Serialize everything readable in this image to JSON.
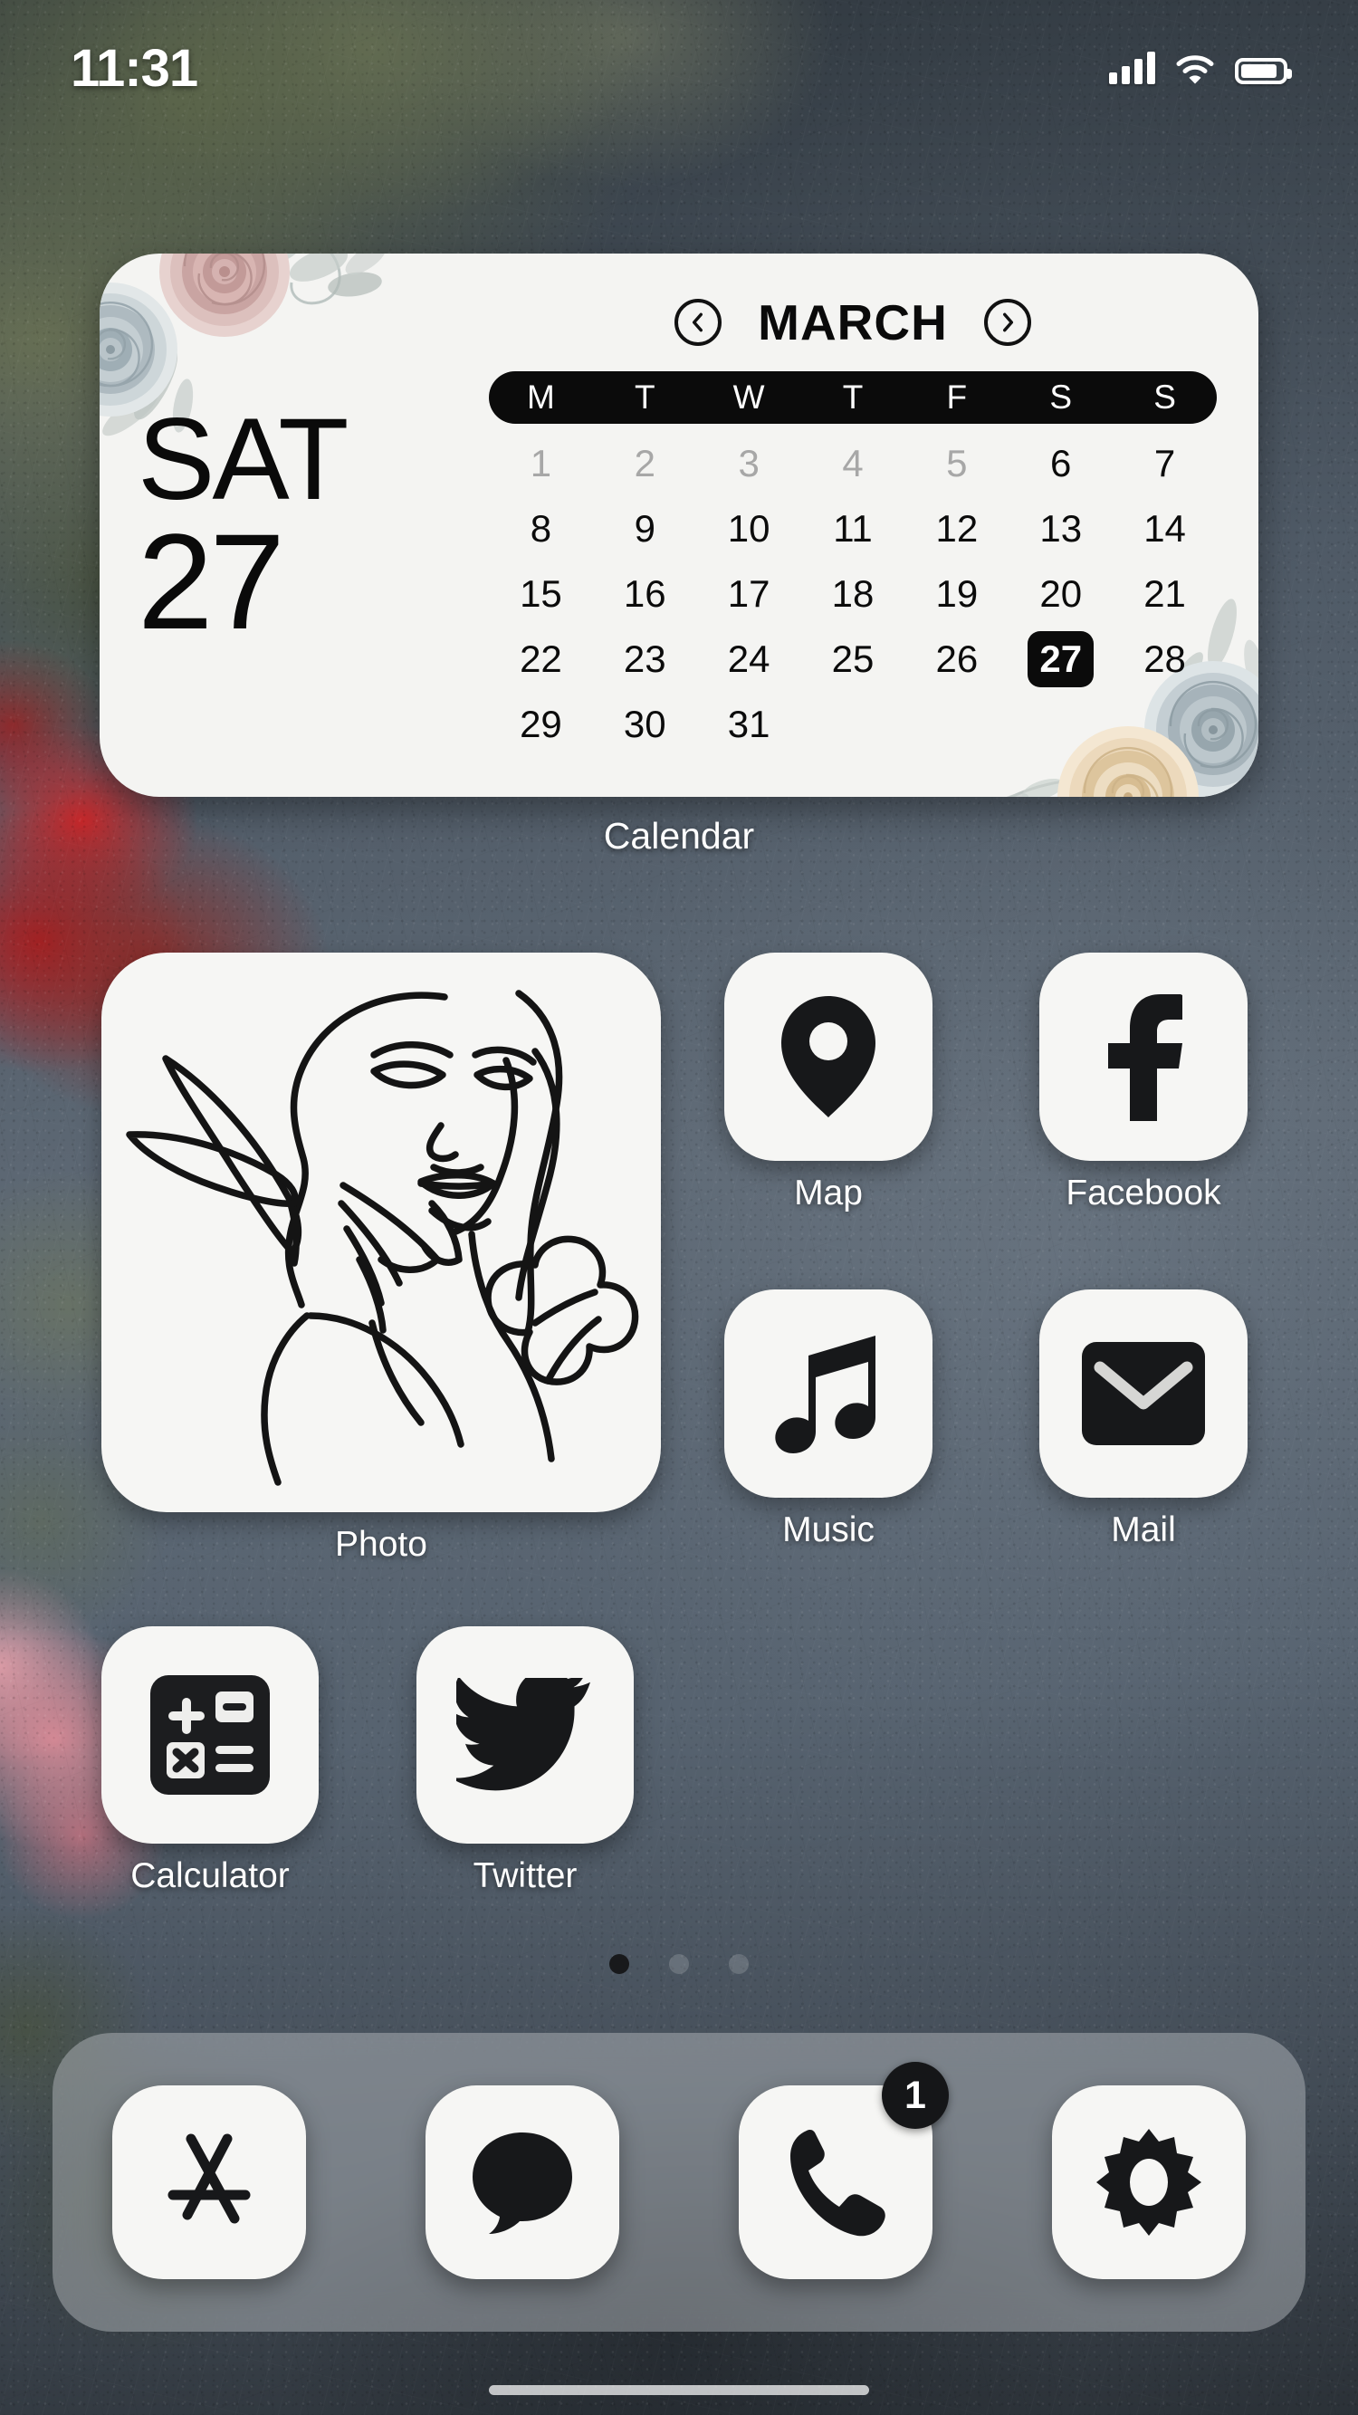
{
  "status_bar": {
    "time": "11:31",
    "signal_icon": "cellular-signal-icon",
    "signal_bars": 4,
    "wifi_icon": "wifi-icon",
    "battery_icon": "battery-icon",
    "battery_level_pct": 88
  },
  "calendar_widget": {
    "label": "Calendar",
    "weekday_abbrev": "SAT",
    "day_number": "27",
    "month": "MARCH",
    "prev_icon": "chevron-left-circle-icon",
    "next_icon": "chevron-right-circle-icon",
    "weekday_headers": [
      "M",
      "T",
      "W",
      "T",
      "F",
      "S",
      "S"
    ],
    "days": [
      {
        "n": "1",
        "state": "muted"
      },
      {
        "n": "2",
        "state": "muted"
      },
      {
        "n": "3",
        "state": "muted"
      },
      {
        "n": "4",
        "state": "muted"
      },
      {
        "n": "5",
        "state": "muted"
      },
      {
        "n": "6",
        "state": "normal"
      },
      {
        "n": "7",
        "state": "normal"
      },
      {
        "n": "8",
        "state": "normal"
      },
      {
        "n": "9",
        "state": "normal"
      },
      {
        "n": "10",
        "state": "normal"
      },
      {
        "n": "11",
        "state": "normal"
      },
      {
        "n": "12",
        "state": "normal"
      },
      {
        "n": "13",
        "state": "normal"
      },
      {
        "n": "14",
        "state": "normal"
      },
      {
        "n": "15",
        "state": "normal"
      },
      {
        "n": "16",
        "state": "normal"
      },
      {
        "n": "17",
        "state": "normal"
      },
      {
        "n": "18",
        "state": "normal"
      },
      {
        "n": "19",
        "state": "normal"
      },
      {
        "n": "20",
        "state": "normal"
      },
      {
        "n": "21",
        "state": "normal"
      },
      {
        "n": "22",
        "state": "normal"
      },
      {
        "n": "23",
        "state": "normal"
      },
      {
        "n": "24",
        "state": "normal"
      },
      {
        "n": "25",
        "state": "normal"
      },
      {
        "n": "26",
        "state": "normal"
      },
      {
        "n": "27",
        "state": "today"
      },
      {
        "n": "28",
        "state": "normal"
      },
      {
        "n": "29",
        "state": "normal"
      },
      {
        "n": "30",
        "state": "normal"
      },
      {
        "n": "31",
        "state": "normal"
      }
    ],
    "decoration": "floral-rose-corners"
  },
  "home_apps": [
    {
      "label": "Photo",
      "icon": "line-art-woman-portrait-icon"
    },
    {
      "label": "Map",
      "icon": "location-pin-icon"
    },
    {
      "label": "Facebook",
      "icon": "facebook-f-icon"
    },
    {
      "label": "Music",
      "icon": "music-note-icon"
    },
    {
      "label": "Mail",
      "icon": "envelope-icon"
    },
    {
      "label": "Calculator",
      "icon": "calculator-icon"
    },
    {
      "label": "Twitter",
      "icon": "twitter-bird-icon"
    }
  ],
  "page_indicator": {
    "total_pages": 3,
    "current_page": 1
  },
  "dock": [
    {
      "name": "App Store",
      "icon": "app-store-icon",
      "badge": null
    },
    {
      "name": "Messages",
      "icon": "speech-bubble-icon",
      "badge": null
    },
    {
      "name": "Phone",
      "icon": "phone-handset-icon",
      "badge": "1"
    },
    {
      "name": "Settings",
      "icon": "gear-icon",
      "badge": null
    }
  ],
  "colors": {
    "icon_tile": "#f6f6f4",
    "icon_glyph": "#111111",
    "widget_bg": "#f4f4f2",
    "accent_black": "#0b0b0b",
    "label_text": "#ffffff",
    "dock_bg": "rgba(188,192,196,0.46)",
    "muted_day": "#a7a7a7"
  }
}
